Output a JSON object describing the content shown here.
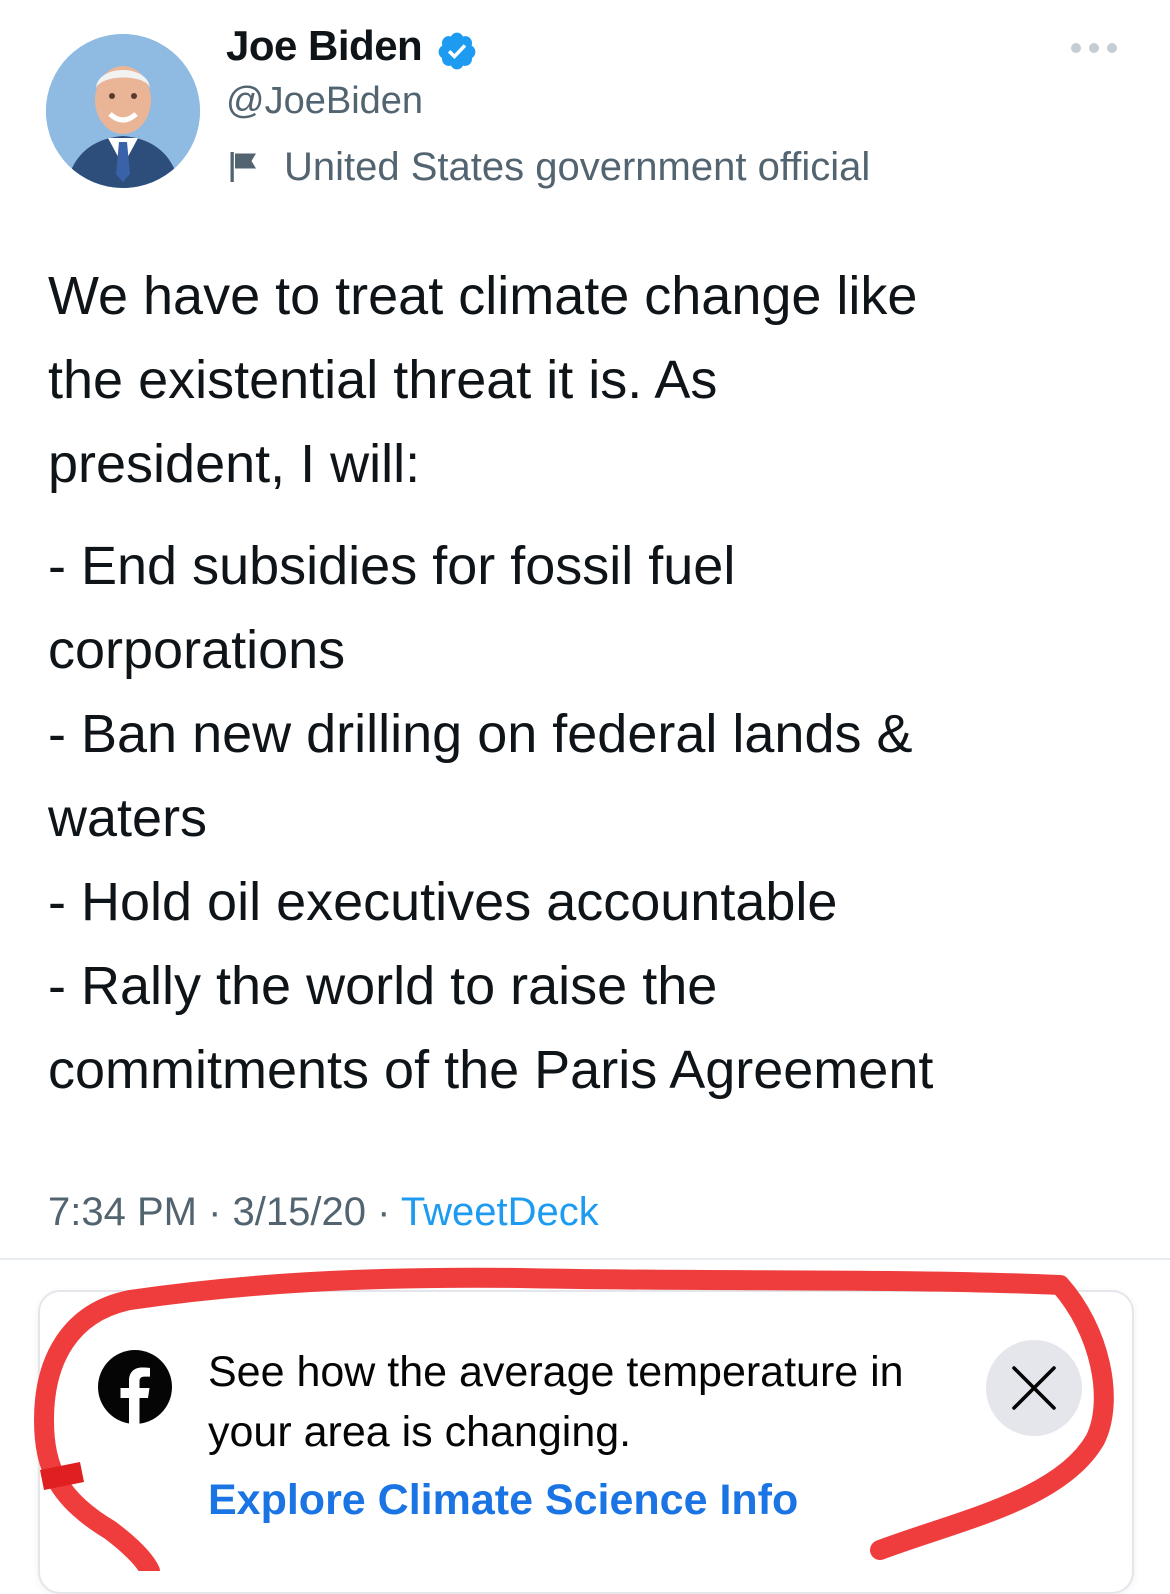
{
  "author": {
    "display_name": "Joe Biden",
    "handle": "@JoeBiden",
    "label": "United States government official",
    "avatar_icon": "profile-photo",
    "verified_icon": "verified-badge-icon",
    "label_icon": "flag-icon"
  },
  "tweet": {
    "lines": [
      "We have to treat climate change like",
      "the existential threat it is. As",
      "president, I will:",
      "- End subsidies for fossil fuel",
      "corporations",
      "- Ban new drilling on federal lands &",
      "waters",
      "- Hold oil executives accountable",
      "- Rally the world to raise the",
      "commitments of the Paris Agreement"
    ],
    "time": "7:34 PM",
    "date": "3/15/20",
    "separator": "·",
    "source": "TweetDeck"
  },
  "notice": {
    "text": "See how the average temperature in your area is changing.",
    "link": "Explore Climate Science Info",
    "brand_icon": "facebook-icon",
    "close_icon": "close-icon"
  },
  "colors": {
    "verified": "#1d9bf0",
    "link": "#1b74e4",
    "secondary_text": "#536471",
    "annotation": "#ee3333"
  }
}
